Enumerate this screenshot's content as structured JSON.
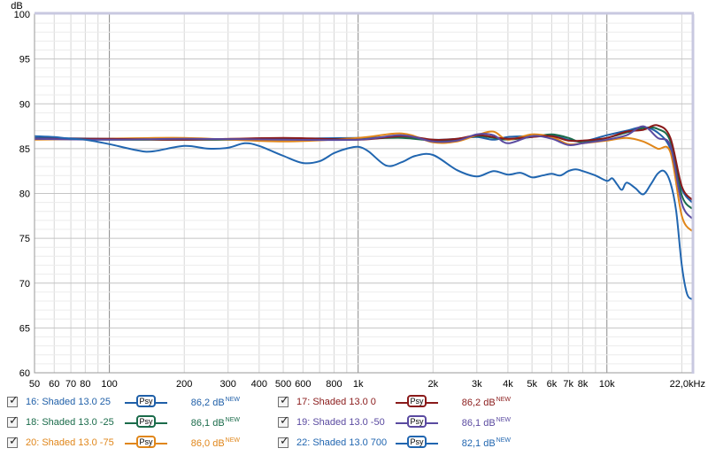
{
  "chart_data": {
    "type": "line",
    "ylabel": "dB",
    "xscale": "log",
    "xlim": [
      50,
      22000
    ],
    "ylim": [
      60,
      100
    ],
    "yticks": [
      "100",
      "95",
      "90",
      "85",
      "80",
      "75",
      "70",
      "65",
      "60"
    ],
    "xticks": [
      {
        "v": 50,
        "label": "50"
      },
      {
        "v": 60,
        "label": "60"
      },
      {
        "v": 70,
        "label": "70"
      },
      {
        "v": 80,
        "label": "80"
      },
      {
        "v": 100,
        "label": "100"
      },
      {
        "v": 200,
        "label": "200"
      },
      {
        "v": 300,
        "label": "300"
      },
      {
        "v": 400,
        "label": "400"
      },
      {
        "v": 500,
        "label": "500"
      },
      {
        "v": 600,
        "label": "600"
      },
      {
        "v": 800,
        "label": "800"
      },
      {
        "v": 1000,
        "label": "1k"
      },
      {
        "v": 2000,
        "label": "2k"
      },
      {
        "v": 3000,
        "label": "3k"
      },
      {
        "v": 4000,
        "label": "4k"
      },
      {
        "v": 5000,
        "label": "5k"
      },
      {
        "v": 6000,
        "label": "6k"
      },
      {
        "v": 7000,
        "label": "7k"
      },
      {
        "v": 8000,
        "label": "8k"
      },
      {
        "v": 10000,
        "label": "10k"
      },
      {
        "v": 22000,
        "label": "22,0kHz"
      }
    ],
    "grid": true,
    "series": [
      {
        "name": "16: Shaded 13.0 25",
        "color": "#1f5fa8",
        "x": [
          50,
          100,
          200,
          500,
          1000,
          1500,
          2000,
          2500,
          3000,
          3500,
          4000,
          5000,
          6000,
          7000,
          8000,
          10000,
          12000,
          14000,
          16000,
          18000,
          20000,
          22000
        ],
        "y": [
          86.2,
          86.1,
          86.0,
          86.1,
          86.2,
          86.3,
          86.0,
          86.1,
          86.3,
          86.0,
          86.3,
          86.4,
          86.5,
          86.0,
          85.8,
          86.5,
          87.0,
          87.4,
          86.8,
          85.0,
          80.5,
          79.0
        ]
      },
      {
        "name": "18: Shaded 13.0 -25",
        "color": "#1a6b4a",
        "x": [
          50,
          100,
          200,
          500,
          1000,
          1500,
          2000,
          2500,
          3000,
          3500,
          4000,
          5000,
          6000,
          7000,
          8000,
          10000,
          12000,
          14000,
          16000,
          18000,
          20000,
          22000
        ],
        "y": [
          86.1,
          86.0,
          86.0,
          86.0,
          86.1,
          86.2,
          85.9,
          86.0,
          86.4,
          86.2,
          86.0,
          86.3,
          86.6,
          86.2,
          85.7,
          86.2,
          86.8,
          87.3,
          87.2,
          85.8,
          79.8,
          78.3
        ]
      },
      {
        "name": "20: Shaded 13.0 -75",
        "color": "#e0861a",
        "x": [
          50,
          100,
          200,
          500,
          1000,
          1500,
          2000,
          2500,
          3000,
          3500,
          4000,
          5000,
          6000,
          7000,
          8000,
          10000,
          12000,
          14000,
          16000,
          18000,
          20000,
          22000
        ],
        "y": [
          86.0,
          86.1,
          86.2,
          85.8,
          86.2,
          86.7,
          85.7,
          85.8,
          86.5,
          86.9,
          86.0,
          86.6,
          86.3,
          85.5,
          85.6,
          85.9,
          86.2,
          85.8,
          85.0,
          84.6,
          77.5,
          75.8
        ]
      },
      {
        "name": "17: Shaded 13.0 0",
        "color": "#8a1a1a",
        "x": [
          50,
          100,
          200,
          500,
          1000,
          1500,
          2000,
          2500,
          3000,
          3500,
          4000,
          5000,
          6000,
          7000,
          8000,
          10000,
          12000,
          14000,
          16000,
          18000,
          20000,
          22000
        ],
        "y": [
          86.1,
          86.1,
          86.0,
          86.2,
          86.0,
          86.4,
          86.0,
          86.1,
          86.5,
          86.3,
          86.1,
          86.3,
          86.4,
          85.9,
          85.9,
          86.2,
          86.9,
          87.1,
          87.6,
          86.2,
          80.8,
          79.3
        ]
      },
      {
        "name": "19: Shaded 13.0 -50",
        "color": "#5a4aa0",
        "x": [
          50,
          100,
          200,
          500,
          1000,
          1500,
          2000,
          2500,
          3000,
          3500,
          4000,
          5000,
          6000,
          7000,
          8000,
          10000,
          12000,
          14000,
          16000,
          18000,
          20000,
          22000
        ],
        "y": [
          86.1,
          86.0,
          86.1,
          86.0,
          86.0,
          86.5,
          85.8,
          85.9,
          86.6,
          86.5,
          85.6,
          86.4,
          86.1,
          85.4,
          85.6,
          86.0,
          86.5,
          87.5,
          86.2,
          85.3,
          78.9,
          77.2
        ]
      },
      {
        "name": "22: Shaded 13.0 700",
        "color": "#2166b0",
        "x": [
          50,
          60,
          70,
          80,
          100,
          130,
          150,
          200,
          250,
          300,
          350,
          400,
          500,
          600,
          700,
          800,
          900,
          1000,
          1100,
          1300,
          1500,
          1700,
          2000,
          2500,
          3000,
          3500,
          4000,
          4500,
          5000,
          5500,
          6000,
          6500,
          7000,
          7500,
          8000,
          9000,
          10000,
          10500,
          11000,
          11500,
          12000,
          13000,
          14000,
          15000,
          16000,
          17000,
          18000,
          19000,
          20000,
          21000,
          22000
        ],
        "y": [
          86.4,
          86.3,
          86.1,
          86.0,
          85.5,
          84.8,
          84.7,
          85.3,
          85.0,
          85.1,
          85.6,
          85.3,
          84.2,
          83.4,
          83.6,
          84.5,
          85.0,
          85.2,
          84.7,
          83.1,
          83.5,
          84.2,
          84.3,
          82.6,
          81.9,
          82.5,
          82.1,
          82.3,
          81.8,
          82.0,
          82.2,
          82.0,
          82.5,
          82.7,
          82.5,
          82.0,
          81.4,
          81.7,
          81.0,
          80.4,
          81.2,
          80.6,
          79.9,
          81.0,
          82.2,
          82.5,
          81.2,
          78.0,
          72.0,
          68.8,
          68.2
        ]
      }
    ]
  },
  "legend": [
    {
      "label": "16: Shaded 13.0 25",
      "psy": "Psy",
      "value": "86,2 dB",
      "badge": "NEW",
      "color": "#1f5fa8"
    },
    {
      "label": "17: Shaded 13.0 0",
      "psy": "Psy",
      "value": "86,2 dB",
      "badge": "NEW",
      "color": "#8a1a1a"
    },
    {
      "label": "18: Shaded 13.0 -25",
      "psy": "Psy",
      "value": "86,1 dB",
      "badge": "NEW",
      "color": "#1a6b4a"
    },
    {
      "label": "19: Shaded 13.0 -50",
      "psy": "Psy",
      "value": "86,1 dB",
      "badge": "NEW",
      "color": "#5a4aa0"
    },
    {
      "label": "20: Shaded 13.0 -75",
      "psy": "Psy",
      "value": "86,0 dB",
      "badge": "NEW",
      "color": "#e0861a"
    },
    {
      "label": "22: Shaded 13.0 700",
      "psy": "Psy",
      "value": "82,1 dB",
      "badge": "NEW",
      "color": "#2166b0"
    }
  ],
  "checkbox_mark": "✓"
}
